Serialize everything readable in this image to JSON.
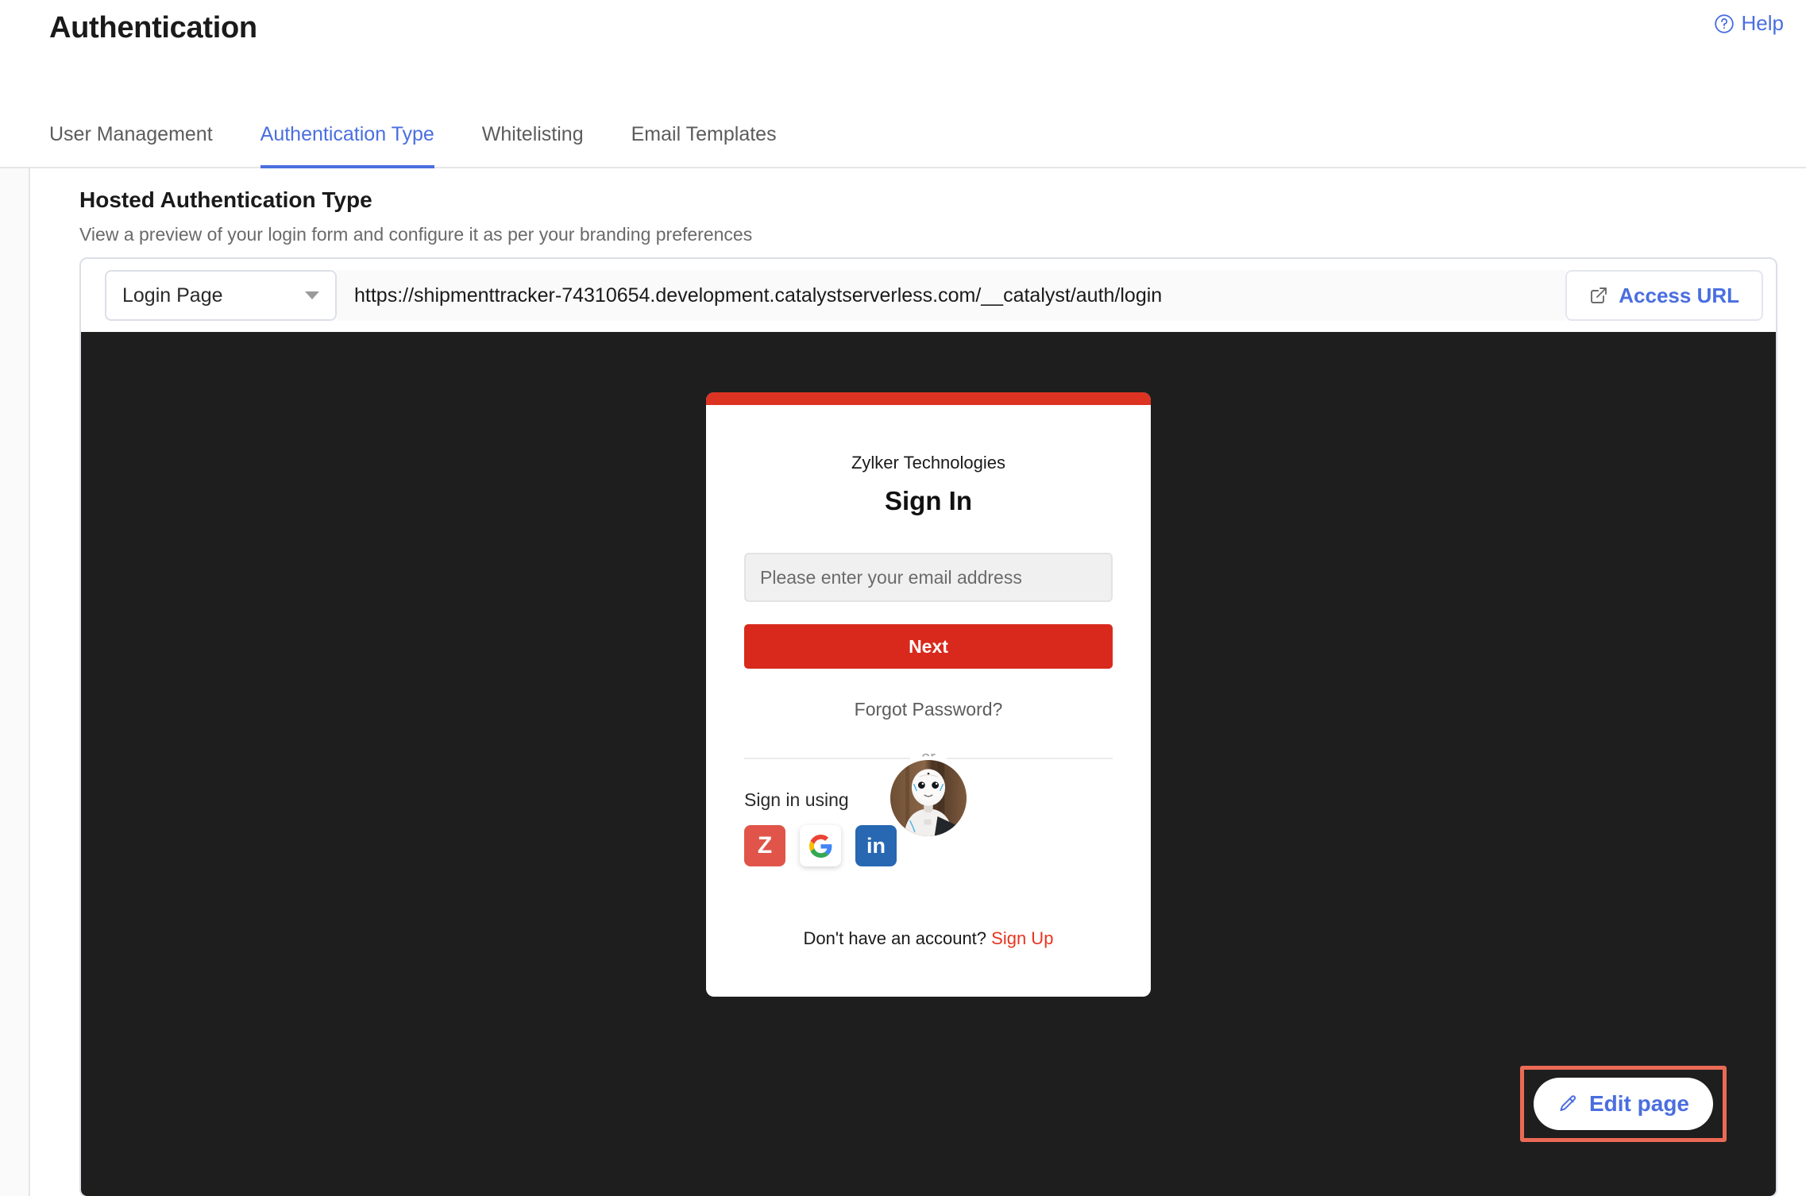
{
  "header": {
    "title": "Authentication",
    "help_label": "Help",
    "help_icon": "question-circle-icon"
  },
  "tabs": [
    {
      "label": "User Management",
      "active": false
    },
    {
      "label": "Authentication Type",
      "active": true
    },
    {
      "label": "Whitelisting",
      "active": false
    },
    {
      "label": "Email Templates",
      "active": false
    }
  ],
  "section": {
    "title": "Hosted Authentication Type",
    "subtitle": "View a preview of your login form and configure it as per your branding preferences"
  },
  "url_row": {
    "page_select_value": "Login Page",
    "page_select_caret": "chevron-down-icon",
    "url": "https://shipmenttracker-74310654.development.catalystserverless.com/__catalyst/auth/login",
    "access_label": "Access URL",
    "access_icon": "external-link-icon"
  },
  "login_preview": {
    "avatar_icon": "pepper-robot-avatar",
    "org_name": "Zylker Technologies",
    "title": "Sign In",
    "email_placeholder": "Please enter your email address",
    "email_value": "",
    "next_label": "Next",
    "forgot_label": "Forgot Password?",
    "or_label": "or",
    "sign_in_using_label": "Sign in using",
    "social_buttons": [
      {
        "name": "zoho",
        "glyph": "Z",
        "color": "#e05449"
      },
      {
        "name": "google",
        "glyph": "G",
        "color": "#ffffff"
      },
      {
        "name": "linkedin",
        "glyph": "in",
        "color": "#2867b2"
      }
    ],
    "signup_prompt": "Don't have an account?",
    "signup_link": "Sign Up",
    "accent_color": "#d8291c",
    "background_color": "#1e1e1e"
  },
  "edit_page": {
    "label": "Edit page",
    "icon": "pencil-icon",
    "highlight_color": "#eb6a55"
  }
}
